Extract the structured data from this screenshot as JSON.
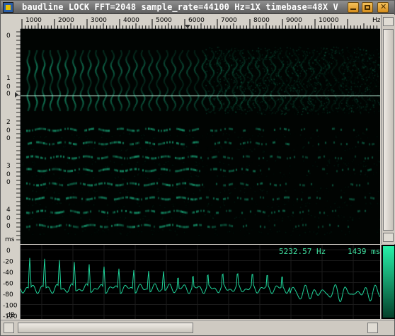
{
  "window": {
    "title": "baudline  LOCK FFT=2048 sample_rate=44100 Hz=1X timebase=48X  V",
    "minimize_glyph": "_",
    "maximize_glyph": "□",
    "close_glyph": "✕"
  },
  "freq_ruler": {
    "labels": [
      "1000",
      "2000",
      "3000",
      "4000",
      "5000",
      "6000",
      "7000",
      "8000",
      "9000",
      "10000",
      "Hz"
    ]
  },
  "time_axis": {
    "labels": [
      "0",
      "1",
      "0",
      "0",
      "2",
      "0",
      "0",
      "3",
      "0",
      "0",
      "4",
      "0",
      "0",
      "ms"
    ]
  },
  "spectrum_axis": {
    "labels": [
      "0",
      "-20",
      "-40",
      "-60",
      "-80",
      "-100",
      "-120",
      "dB"
    ]
  },
  "readout": {
    "frequency": "5232.57 Hz",
    "time": "1439 ms"
  },
  "colors": {
    "signal": "#1fd49a",
    "background": "#000000",
    "cursor_line": "#c8ffe8"
  },
  "icons": {
    "app": "baudline-app-icon",
    "up": "arrow-up-icon",
    "down": "arrow-down-icon",
    "left": "arrow-left-icon",
    "right": "arrow-right-icon",
    "marker": "triangle-marker-icon"
  }
}
